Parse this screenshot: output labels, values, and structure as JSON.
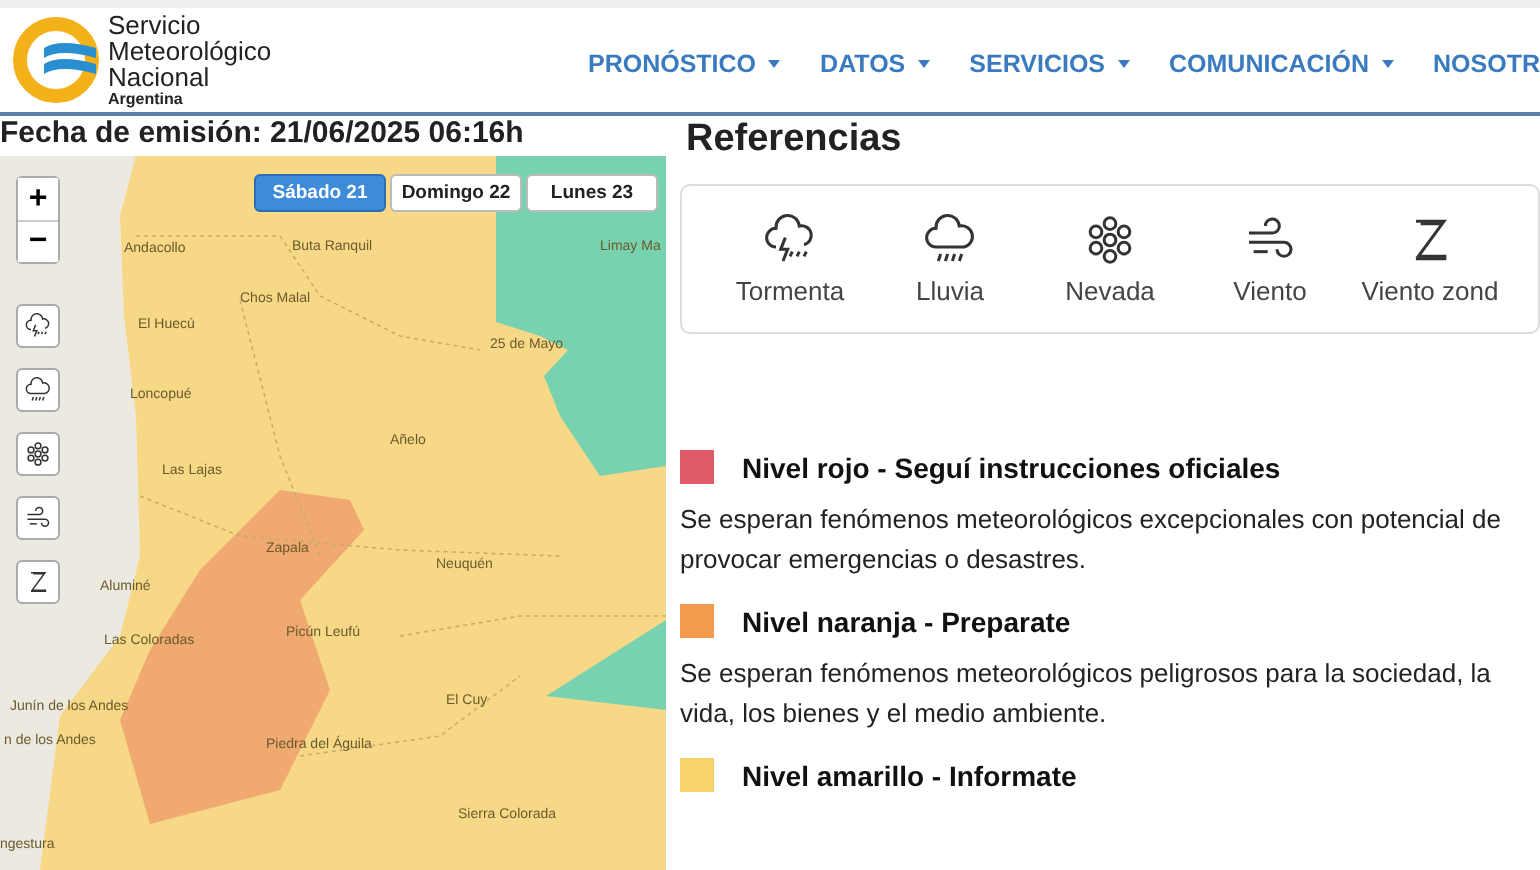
{
  "header": {
    "logo_lines": [
      "Servicio",
      "Meteorológico",
      "Nacional"
    ],
    "logo_country": "Argentina",
    "nav": [
      {
        "label": "PRONÓSTICO",
        "dropdown": true
      },
      {
        "label": "DATOS",
        "dropdown": true
      },
      {
        "label": "SERVICIOS",
        "dropdown": true
      },
      {
        "label": "COMUNICACIÓN",
        "dropdown": true
      },
      {
        "label": "NOSOTR",
        "dropdown": false
      }
    ]
  },
  "issue_date": "Fecha de emisión: 21/06/2025 06:16h",
  "map": {
    "zoom_in": "+",
    "zoom_out": "−",
    "layers": [
      {
        "kind": "storm"
      },
      {
        "kind": "rain"
      },
      {
        "kind": "snow"
      },
      {
        "kind": "wind"
      },
      {
        "kind": "zonda"
      }
    ],
    "days": [
      {
        "label": "Sábado 21",
        "selected": true
      },
      {
        "label": "Domingo 22",
        "selected": false
      },
      {
        "label": "Lunes 23",
        "selected": false
      }
    ],
    "places": [
      {
        "name": "Andacollo"
      },
      {
        "name": "Buta Ranquil"
      },
      {
        "name": "Limay Ma"
      },
      {
        "name": "Chos Malal"
      },
      {
        "name": "El Huecú"
      },
      {
        "name": "25 de Mayo"
      },
      {
        "name": "Loncopué"
      },
      {
        "name": "Añelo"
      },
      {
        "name": "Las Lajas"
      },
      {
        "name": "Zapala"
      },
      {
        "name": "Neuquén"
      },
      {
        "name": "Aluminé"
      },
      {
        "name": "Picún Leufú"
      },
      {
        "name": "Las Coloradas"
      },
      {
        "name": "Junín de los Andes"
      },
      {
        "name": "El Cuy"
      },
      {
        "name": "n de los Andes"
      },
      {
        "name": "Piedra del Águila"
      },
      {
        "name": "Sierra Colorada"
      },
      {
        "name": "ngestura"
      }
    ]
  },
  "references": {
    "title": "Referencias",
    "items": [
      {
        "kind": "storm",
        "label": "Tormenta"
      },
      {
        "kind": "rain",
        "label": "Lluvia"
      },
      {
        "kind": "snow",
        "label": "Nevada"
      },
      {
        "kind": "wind",
        "label": "Viento"
      },
      {
        "kind": "zonda",
        "label": "Viento zond"
      }
    ]
  },
  "levels": [
    {
      "color": "#e05a6a",
      "title": "Nivel rojo - Seguí instrucciones oficiales",
      "description": "Se esperan fenómenos meteorológicos excepcionales con potencial de provocar emergencias o desastres."
    },
    {
      "color": "#f29a4e",
      "title": "Nivel naranja - Preparate",
      "description": "Se esperan fenómenos meteorológicos peligrosos para la sociedad, la vida, los bienes y el medio ambiente."
    },
    {
      "color": "#f8d36a",
      "title": "Nivel amarillo - Informate"
    }
  ]
}
